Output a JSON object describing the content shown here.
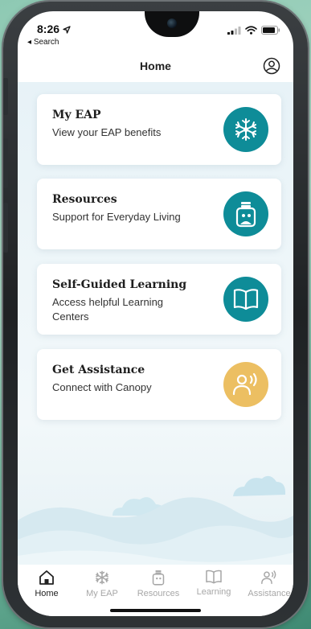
{
  "status": {
    "time": "8:26",
    "back_label": "Search"
  },
  "header": {
    "title": "Home"
  },
  "cards": [
    {
      "title": "My EAP",
      "subtitle": "View your EAP benefits",
      "icon": "eap-icon"
    },
    {
      "title": "Resources",
      "subtitle": "Support for Everyday Living",
      "icon": "resources-icon"
    },
    {
      "title": "Self-Guided Learning",
      "subtitle": "Access helpful Learning Centers",
      "icon": "book-icon"
    },
    {
      "title": "Get Assistance",
      "subtitle": "Connect with Canopy",
      "icon": "assistance-icon"
    }
  ],
  "tabs": [
    {
      "label": "Home",
      "icon": "home-icon",
      "active": true
    },
    {
      "label": "My EAP",
      "icon": "eap-icon",
      "active": false
    },
    {
      "label": "Resources",
      "icon": "resources-icon",
      "active": false
    },
    {
      "label": "Learning",
      "icon": "book-icon",
      "active": false
    },
    {
      "label": "Assistance",
      "icon": "assistance-icon",
      "active": false
    }
  ],
  "colors": {
    "teal": "#0e8c98",
    "gold": "#ecbf62",
    "background": "#e7f2f7"
  }
}
